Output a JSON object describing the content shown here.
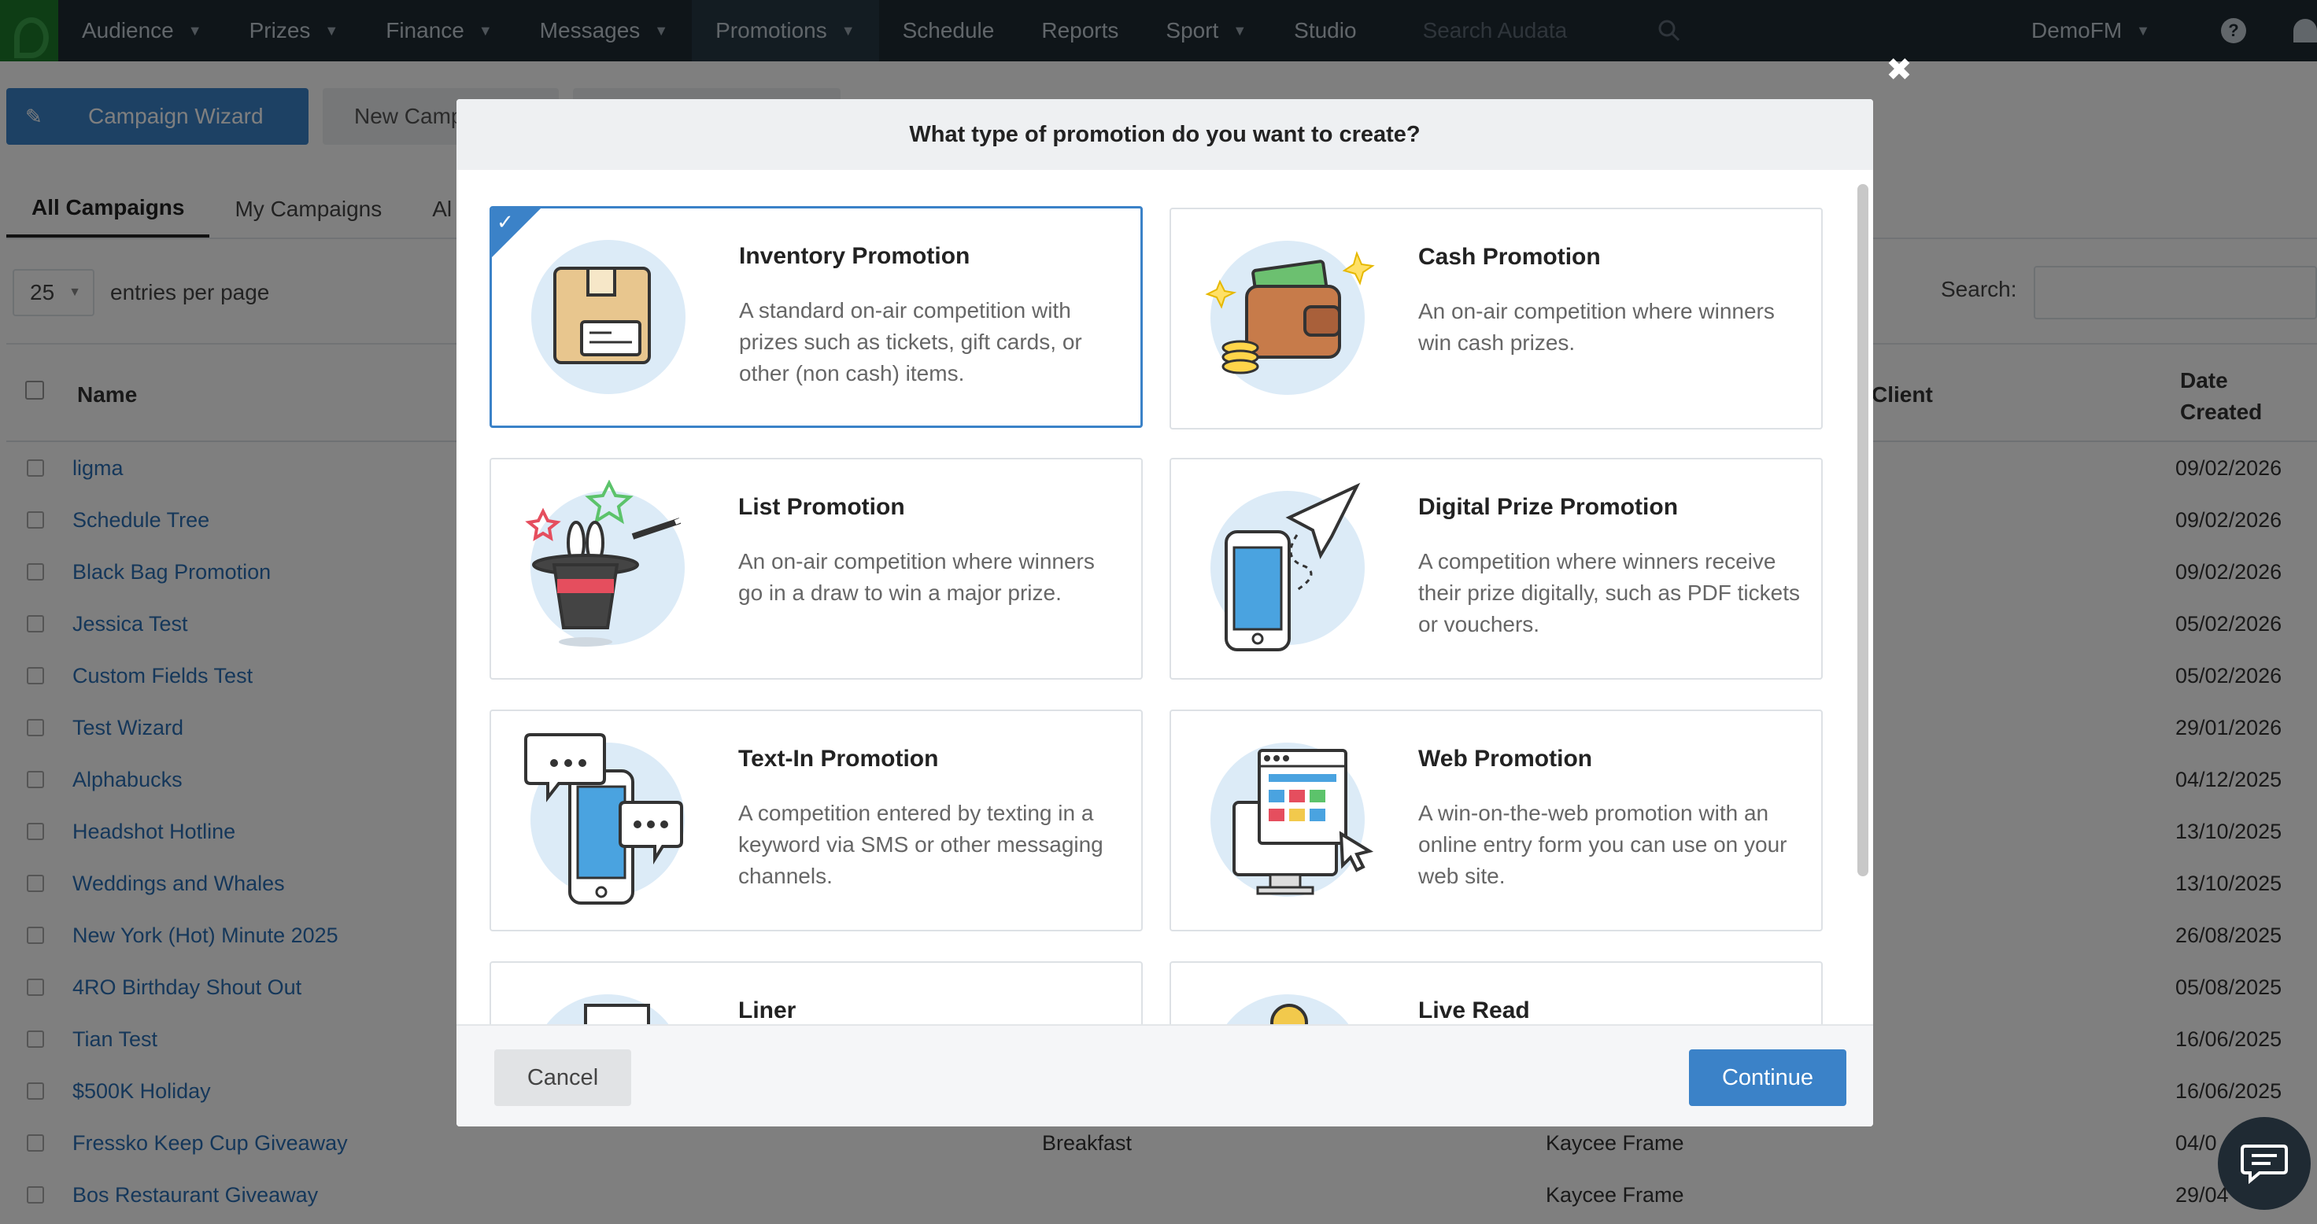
{
  "nav": {
    "items": [
      {
        "label": "Audience",
        "caret": true
      },
      {
        "label": "Prizes",
        "caret": true
      },
      {
        "label": "Finance",
        "caret": true
      },
      {
        "label": "Messages",
        "caret": true
      },
      {
        "label": "Promotions",
        "caret": true,
        "active": true
      },
      {
        "label": "Schedule",
        "caret": false
      },
      {
        "label": "Reports",
        "caret": false
      },
      {
        "label": "Sport",
        "caret": true
      },
      {
        "label": "Studio",
        "caret": false
      }
    ],
    "search_placeholder": "Search Audata",
    "station": "DemoFM",
    "help_icon": "help-icon",
    "user_icon": "user-icon"
  },
  "toolbar": {
    "wizard_label": "Campaign Wizard",
    "new_label": "New Camp"
  },
  "tabs": [
    "All Campaigns",
    "My Campaigns",
    "Al"
  ],
  "entries": {
    "count": "25",
    "label": "entries per page"
  },
  "search": {
    "label": "Search:"
  },
  "table": {
    "headers": {
      "name": "Name",
      "client": "Client",
      "date_line1": "Date",
      "date_line2": "Created"
    },
    "rows": [
      {
        "name": "ligma",
        "date": "09/02/2026",
        "col3": "",
        "client": ""
      },
      {
        "name": "Schedule Tree",
        "date": "09/02/2026",
        "col3": "",
        "client": ""
      },
      {
        "name": "Black Bag Promotion",
        "date": "09/02/2026",
        "col3": "",
        "client": ""
      },
      {
        "name": "Jessica Test",
        "date": "05/02/2026",
        "col3": "",
        "client": ""
      },
      {
        "name": "Custom Fields Test",
        "date": "05/02/2026",
        "col3": "",
        "client": ""
      },
      {
        "name": "Test Wizard",
        "date": "29/01/2026",
        "col3": "",
        "client": ""
      },
      {
        "name": "Alphabucks",
        "date": "04/12/2025",
        "col3": "",
        "client": ""
      },
      {
        "name": "Headshot Hotline",
        "date": "13/10/2025",
        "col3": "",
        "client": ""
      },
      {
        "name": "Weddings and Whales",
        "date": "13/10/2025",
        "col3": "",
        "client": ""
      },
      {
        "name": "New York (Hot) Minute 2025",
        "date": "26/08/2025",
        "col3": "",
        "client": ""
      },
      {
        "name": "4RO Birthday Shout Out",
        "date": "05/08/2025",
        "col3": "",
        "client": ""
      },
      {
        "name": "Tian Test",
        "date": "16/06/2025",
        "col3": "",
        "client": ""
      },
      {
        "name": "$500K Holiday",
        "date": "16/06/2025",
        "col3": "",
        "client": ""
      },
      {
        "name": "Fressko Keep Cup Giveaway",
        "date": "04/0",
        "col3": "Breakfast",
        "client": "Kaycee Frame"
      },
      {
        "name": "Bos Restaurant Giveaway",
        "date": "29/04",
        "col3": "",
        "client": "Kaycee Frame"
      }
    ]
  },
  "modal": {
    "title": "What type of promotion do you want to create?",
    "close_icon": "close-icon",
    "cancel_label": "Cancel",
    "continue_label": "Continue",
    "cards": [
      {
        "title": "Inventory Promotion",
        "desc": "A standard on-air competition with prizes such as tickets, gift cards, or other (non cash) items.",
        "selected": true,
        "icon": "box-icon"
      },
      {
        "title": "Cash Promotion",
        "desc": "An on-air competition where winners win cash prizes.",
        "selected": false,
        "icon": "wallet-icon"
      },
      {
        "title": "List Promotion",
        "desc": "An on-air competition where winners go in a draw to win a major prize.",
        "selected": false,
        "icon": "magic-hat-icon"
      },
      {
        "title": "Digital Prize Promotion",
        "desc": "A competition where winners receive their prize digitally, such as PDF tickets or vouchers.",
        "selected": false,
        "icon": "paper-plane-phone-icon"
      },
      {
        "title": "Text-In Promotion",
        "desc": "A competition entered by texting in a keyword via SMS or other messaging channels.",
        "selected": false,
        "icon": "chat-phone-icon"
      },
      {
        "title": "Web Promotion",
        "desc": "A win-on-the-web promotion with an online entry form you can use on your web site.",
        "selected": false,
        "icon": "web-browser-icon"
      },
      {
        "title": "Liner",
        "desc": "",
        "selected": false,
        "icon": "document-icon"
      },
      {
        "title": "Live Read",
        "desc": "",
        "selected": false,
        "icon": "microphone-icon"
      }
    ]
  },
  "colors": {
    "accent": "#3b82c8",
    "nav_bg": "#1f2a33",
    "link": "#2a6fb5"
  }
}
